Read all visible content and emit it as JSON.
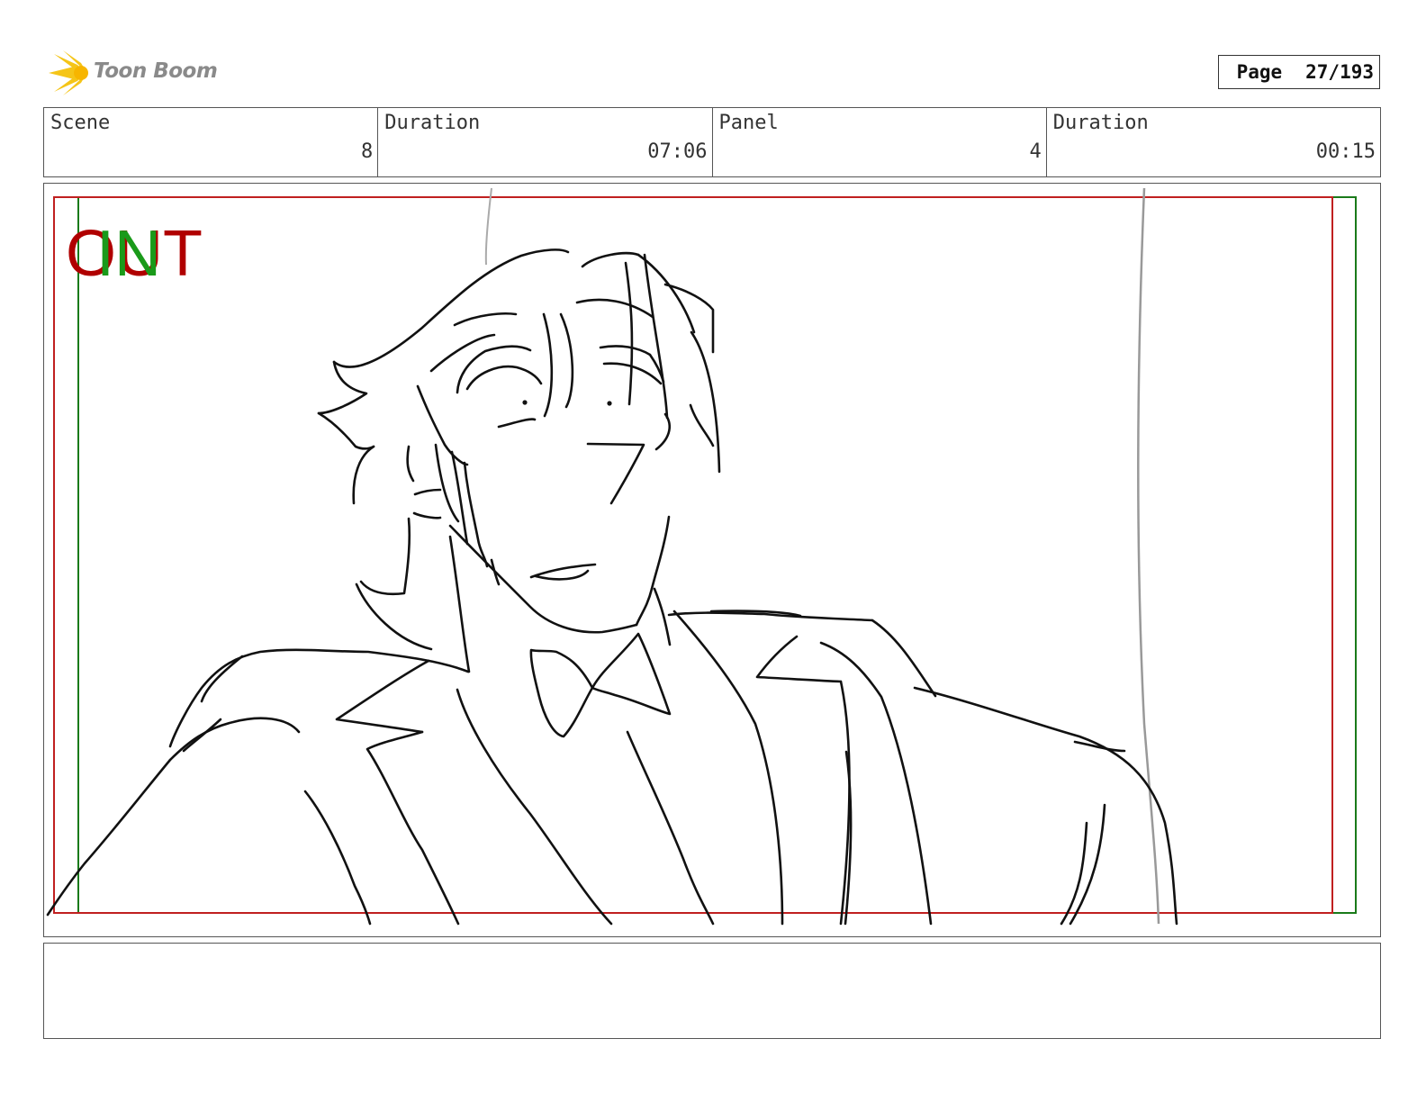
{
  "header": {
    "logo_text": "Toon Boom",
    "page_label": "Page",
    "page_value": "27/193"
  },
  "info": {
    "scene_label": "Scene",
    "scene_value": "8",
    "scene_duration_label": "Duration",
    "scene_duration_value": "07:06",
    "panel_label": "Panel",
    "panel_value": "4",
    "panel_duration_label": "Duration",
    "panel_duration_value": "00:15"
  },
  "panel": {
    "out_marker": "OUT",
    "in_marker": "IN",
    "out_color": "#b00000",
    "in_color": "#1a9a1a"
  },
  "notes": {
    "text": ""
  }
}
